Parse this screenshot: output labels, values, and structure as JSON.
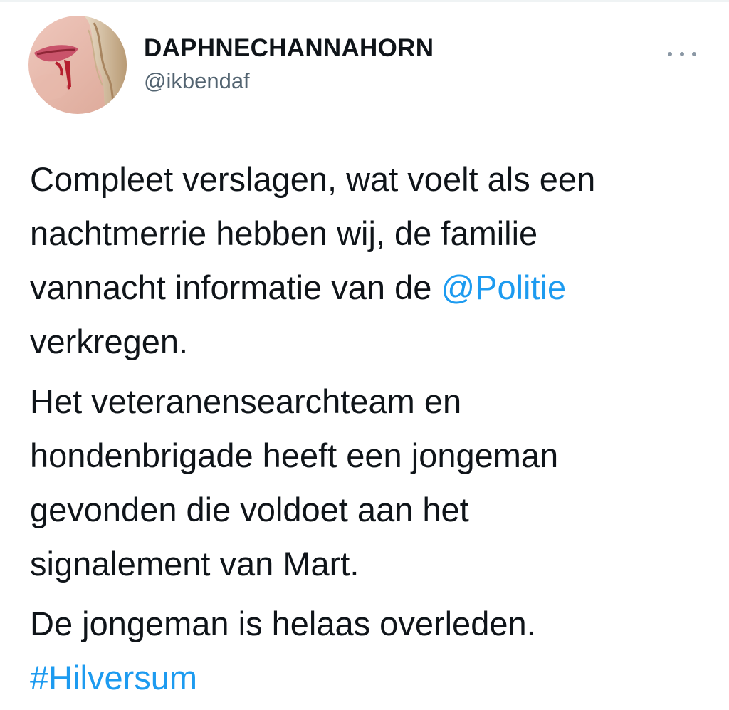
{
  "tweet": {
    "author": {
      "display_name": "DAPHNECHANNAHORN",
      "handle": "@ikbendaf"
    },
    "more_icon": "more-horizontal-icon",
    "colors": {
      "text": "#0f1419",
      "secondary": "#536471",
      "link": "#1d9bf0"
    },
    "paragraphs": [
      {
        "line1": "Compleet verslagen, wat voelt als een",
        "line2": "nachtmerrie hebben wij, de familie",
        "line3": "vannacht informatie van de ",
        "mention": "@Politie",
        "line4": "verkregen."
      },
      {
        "line1": "Het veteranensearchteam en",
        "line2": "hondenbrigade heeft een jongeman",
        "line3": "gevonden die voldoet aan het",
        "line4": "signalement van Mart."
      },
      {
        "line1": "De jongeman is helaas overleden.",
        "hashtag": "#Hilversum"
      }
    ]
  }
}
